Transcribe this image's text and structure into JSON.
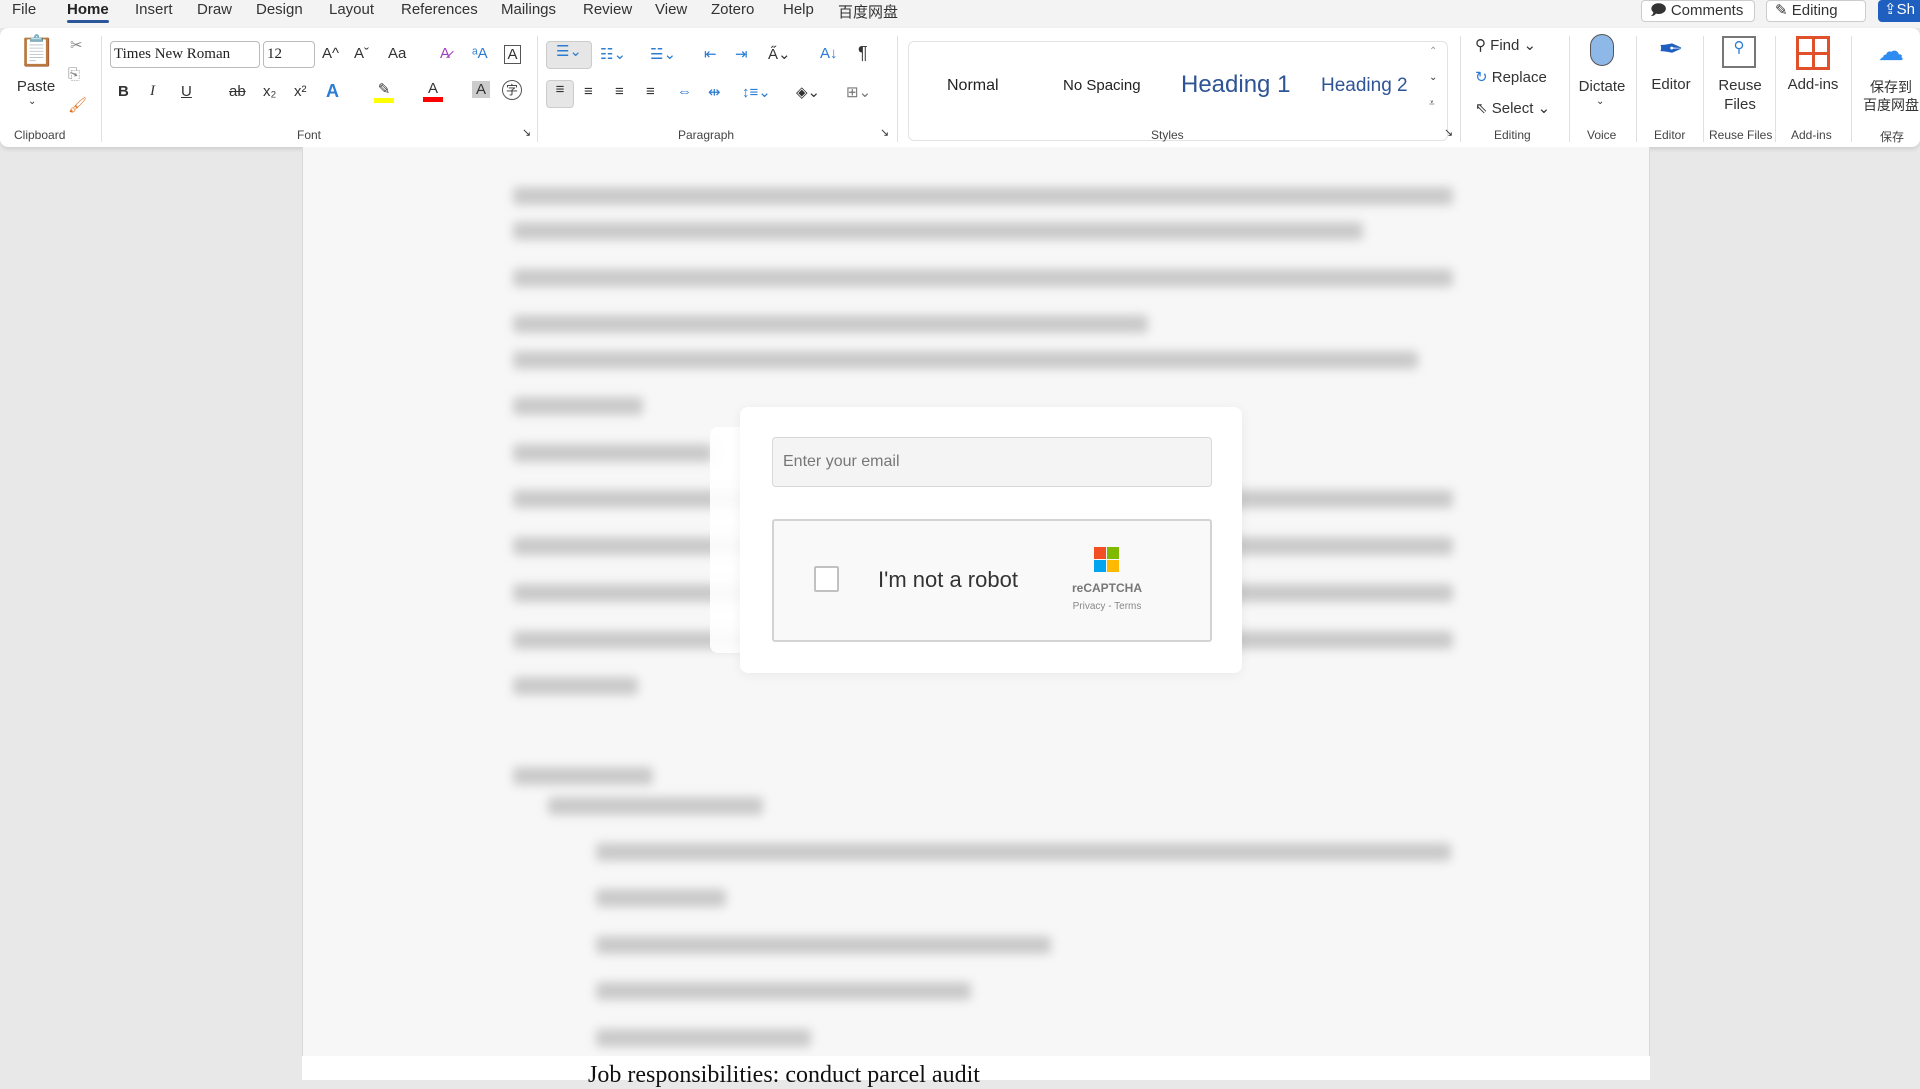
{
  "menu": {
    "tabs": [
      "File",
      "Home",
      "Insert",
      "Draw",
      "Design",
      "Layout",
      "References",
      "Mailings",
      "Review",
      "View",
      "Zotero",
      "Help",
      "百度网盘"
    ],
    "active": "Home",
    "comments": "Comments",
    "editing": "Editing",
    "share": "Sh"
  },
  "ribbon": {
    "clipboard": {
      "paste": "Paste",
      "label": "Clipboard"
    },
    "font": {
      "name": "Times New Roman",
      "size": "12",
      "label": "Font",
      "bold": "B",
      "italic": "I",
      "underline": "U",
      "strike": "ab",
      "sub": "x₂",
      "sup": "x²",
      "grow": "A^",
      "shrink": "Aˇ",
      "case": "Aa"
    },
    "paragraph": {
      "label": "Paragraph",
      "pilcrow": "¶"
    },
    "styles": {
      "label": "Styles",
      "items": [
        "Normal",
        "No Spacing",
        "Heading 1",
        "Heading 2"
      ]
    },
    "editing": {
      "label": "Editing",
      "find": "Find",
      "replace": "Replace",
      "select": "Select"
    },
    "voice": {
      "dictate": "Dictate",
      "label": "Voice"
    },
    "editor": {
      "button": "Editor",
      "label": "Editor"
    },
    "reuse": {
      "button": "Reuse Files",
      "label": "Reuse Files"
    },
    "addins": {
      "button": "Add-ins",
      "label": "Add-ins"
    },
    "baidu": {
      "button1": "保存到",
      "button2": "百度网盘",
      "label": "保存"
    },
    "colors": {
      "accent": "#2b579a",
      "highlight": "#ffff00",
      "fontcolor": "#ff0000"
    }
  },
  "document": {
    "visible_line": "Job responsibilities: conduct parcel audit"
  },
  "dialog": {
    "email_placeholder": "Enter your email",
    "captcha_label": "I'm not a robot",
    "captcha_brand": "reCAPTCHA",
    "captcha_links": "Privacy - Terms",
    "logo_colors": [
      "#f25022",
      "#7fba00",
      "#00a4ef",
      "#ffb900"
    ]
  }
}
